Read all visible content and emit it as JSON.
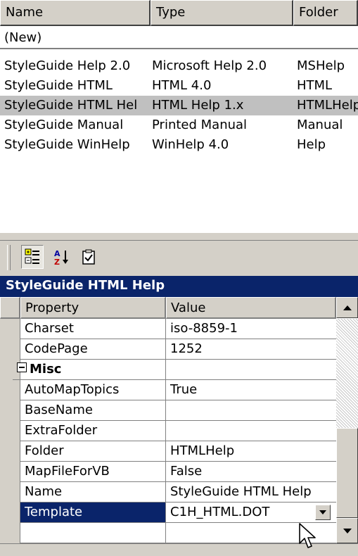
{
  "listview": {
    "columns": [
      "Name",
      "Type",
      "Folder"
    ],
    "new_item": "(New)",
    "rows": [
      {
        "name": "StyleGuide Help 2.0",
        "type": "Microsoft Help 2.0",
        "folder": "MSHelp",
        "selected": false
      },
      {
        "name": "StyleGuide HTML",
        "type": "HTML 4.0",
        "folder": "HTML",
        "selected": false
      },
      {
        "name": "StyleGuide HTML Hel",
        "type": "HTML Help 1.x",
        "folder": "HTMLHelp",
        "selected": true
      },
      {
        "name": "StyleGuide Manual",
        "type": "Printed Manual",
        "folder": "Manual",
        "selected": false
      },
      {
        "name": "StyleGuide WinHelp",
        "type": "WinHelp 4.0",
        "folder": "Help",
        "selected": false
      }
    ]
  },
  "toolbar": {
    "buttons": [
      {
        "icon": "categorized-icon",
        "pressed": true
      },
      {
        "icon": "sort-alphabetical-icon",
        "pressed": false
      },
      {
        "icon": "property-pages-icon",
        "pressed": false
      }
    ]
  },
  "object_title": "StyleGuide HTML Help",
  "grid": {
    "header_property": "Property",
    "header_value": "Value",
    "rows": [
      {
        "name": "Charset",
        "value": "iso-8859-1"
      },
      {
        "name": "CodePage",
        "value": "1252"
      },
      {
        "name": "Misc",
        "value": "",
        "category": true
      },
      {
        "name": "AutoMapTopics",
        "value": "True"
      },
      {
        "name": "BaseName",
        "value": ""
      },
      {
        "name": "ExtraFolder",
        "value": ""
      },
      {
        "name": "Folder",
        "value": "HTMLHelp"
      },
      {
        "name": "MapFileForVB",
        "value": "False"
      },
      {
        "name": "Name",
        "value": "StyleGuide HTML Help"
      },
      {
        "name": "Template",
        "value": "C1H_HTML.DOT",
        "selected": true
      }
    ]
  },
  "colors": {
    "selection": "#0a246a",
    "list_selection": "#c0c0c0",
    "face": "#d4d0c8"
  }
}
